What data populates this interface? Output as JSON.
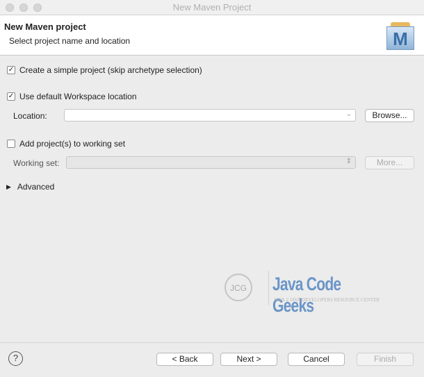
{
  "window": {
    "title": "New Maven Project"
  },
  "header": {
    "title": "New Maven project",
    "subtitle": "Select project name and location",
    "logo_letter": "M"
  },
  "form": {
    "simple_project": {
      "label": "Create a simple project (skip archetype selection)",
      "checked": true
    },
    "default_workspace": {
      "label": "Use default Workspace location",
      "checked": true
    },
    "location": {
      "label": "Location:",
      "value": ""
    },
    "browse": "Browse...",
    "working_set_check": {
      "label": "Add project(s) to working set",
      "checked": false
    },
    "working_set": {
      "label": "Working set:",
      "value": ""
    },
    "more": "More...",
    "advanced": "Advanced"
  },
  "watermark": {
    "brand": "Java Code Geeks",
    "tagline": "Java 2 Java Developers Resource Center",
    "mark": "JCG"
  },
  "footer": {
    "back": "< Back",
    "next": "Next >",
    "cancel": "Cancel",
    "finish": "Finish"
  }
}
